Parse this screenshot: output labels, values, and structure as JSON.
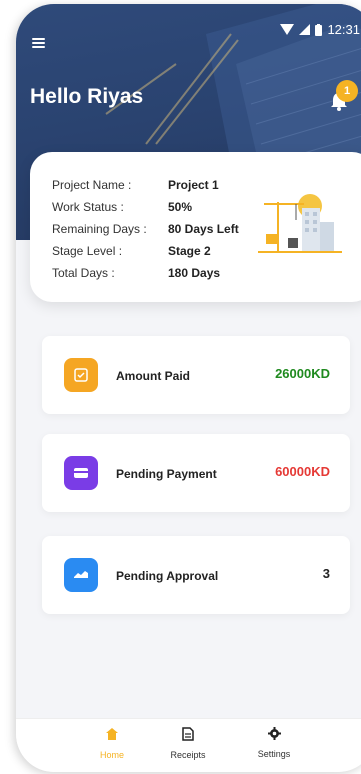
{
  "status_bar": {
    "time": "12:31"
  },
  "header": {
    "greeting": "Hello Riyas",
    "notification_count": "1"
  },
  "project": {
    "rows": [
      {
        "label": "Project Name :",
        "value": "Project 1"
      },
      {
        "label": "Work Status :",
        "value": "50%"
      },
      {
        "label": "Remaining Days :",
        "value": "80 Days Left"
      },
      {
        "label": "Stage Level :",
        "value": "Stage 2"
      },
      {
        "label": "Total Days :",
        "value": "180 Days"
      }
    ]
  },
  "stats": [
    {
      "label": "Amount Paid",
      "value": "26000KD",
      "value_color": "#1f8a1f",
      "icon": "wallet-icon",
      "icon_color": "#f5a623"
    },
    {
      "label": "Pending Payment",
      "value": "60000KD",
      "value_color": "#e53935",
      "icon": "credit-card-icon",
      "icon_color": "#7a3ce6"
    },
    {
      "label": "Pending Approval",
      "value": "3",
      "value_color": "#222222",
      "icon": "approval-icon",
      "icon_color": "#2a8bf2"
    }
  ],
  "tabs": [
    {
      "label": "Home",
      "icon": "home-icon",
      "active": true
    },
    {
      "label": "Receipts",
      "icon": "receipt-icon",
      "active": false
    },
    {
      "label": "Settings",
      "icon": "gear-icon",
      "active": false
    }
  ],
  "colors": {
    "accent": "#f5b324",
    "header_bg": "#2a4370"
  }
}
